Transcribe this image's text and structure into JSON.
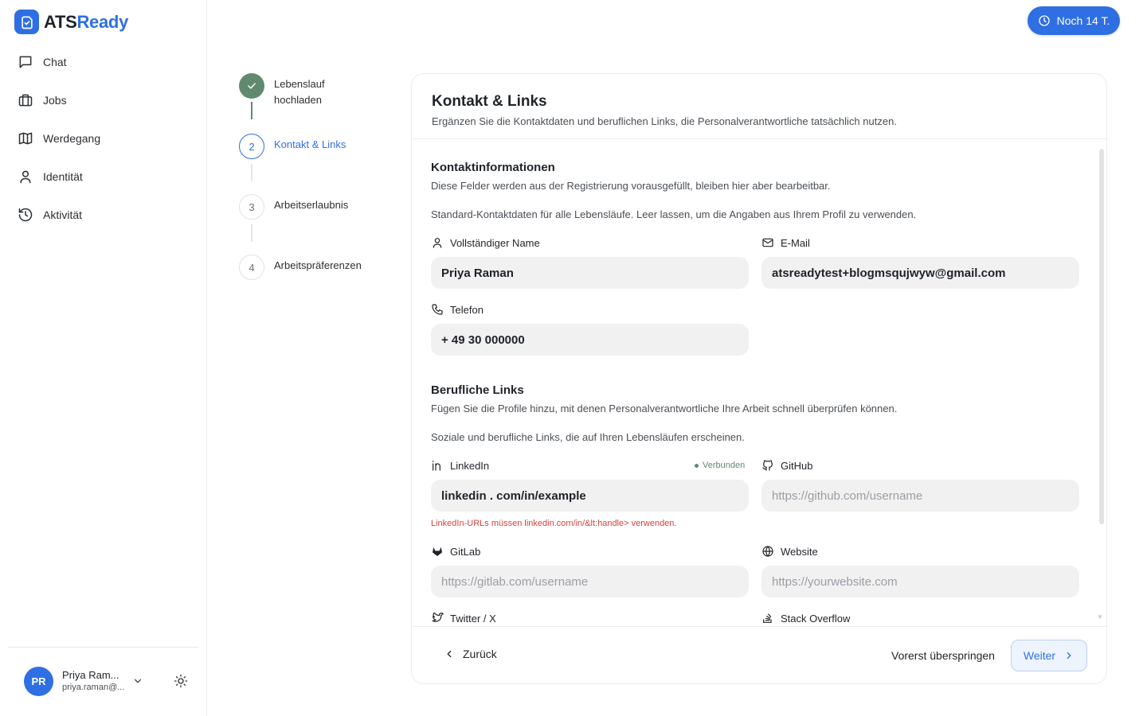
{
  "brand": {
    "name_part1": "ATS",
    "name_part2": "Ready"
  },
  "nav": [
    {
      "label": "Chat",
      "icon": "chat-icon"
    },
    {
      "label": "Jobs",
      "icon": "briefcase-icon"
    },
    {
      "label": "Werdegang",
      "icon": "map-icon"
    },
    {
      "label": "Identität",
      "icon": "user-icon"
    },
    {
      "label": "Aktivität",
      "icon": "history-icon"
    }
  ],
  "user": {
    "initials": "PR",
    "name": "Priya Ram...",
    "email": "priya.raman@..."
  },
  "trial": {
    "label": "Noch 14 T."
  },
  "steps": [
    {
      "number": "",
      "label": "Lebenslauf hochladen",
      "state": "done"
    },
    {
      "number": "2",
      "label": "Kontakt & Links",
      "state": "active"
    },
    {
      "number": "3",
      "label": "Arbeitserlaubnis",
      "state": "todo"
    },
    {
      "number": "4",
      "label": "Arbeitspräferenzen",
      "state": "todo"
    }
  ],
  "card": {
    "title": "Kontakt & Links",
    "subtitle": "Ergänzen Sie die Kontaktdaten und beruflichen Links, die Personalverantwortliche tatsächlich nutzen."
  },
  "contact": {
    "title": "Kontaktinformationen",
    "subtitle": "Diese Felder werden aus der Registrierung vorausgefüllt, bleiben hier aber bearbeitbar.",
    "hint": "Standard-Kontaktdaten für alle Lebensläufe. Leer lassen, um die Angaben aus Ihrem Profil zu verwenden.",
    "name_label": "Vollständiger Name",
    "name_value": "Priya Raman",
    "email_label": "E-Mail",
    "email_value": "atsreadytest+blogmsqujwyw@gmail.com",
    "phone_label": "Telefon",
    "phone_value": "+ 49 30 000000"
  },
  "links": {
    "title": "Berufliche Links",
    "subtitle": "Fügen Sie die Profile hinzu, mit denen Personalverantwortliche Ihre Arbeit schnell überprüfen können.",
    "hint": "Soziale und berufliche Links, die auf Ihren Lebensläufen erscheinen.",
    "linkedin_label": "LinkedIn",
    "linkedin_status": "Verbunden",
    "linkedin_value": "linkedin . com/in/example",
    "linkedin_error": "LinkedIn-URLs müssen linkedin.com/in/&lt:handle> verwenden.",
    "github_label": "GitHub",
    "github_placeholder": "https://github.com/username",
    "gitlab_label": "GitLab",
    "gitlab_placeholder": "https://gitlab.com/username",
    "website_label": "Website",
    "website_placeholder": "https://yourwebsite.com",
    "twitter_label": "Twitter / X",
    "stackoverflow_label": "Stack Overflow"
  },
  "footer": {
    "back": "Zurück",
    "skip": "Vorerst überspringen",
    "next": "Weiter"
  },
  "colors": {
    "accent": "#2f6fe4",
    "success": "#5f8a6e",
    "error": "#d9413a"
  }
}
